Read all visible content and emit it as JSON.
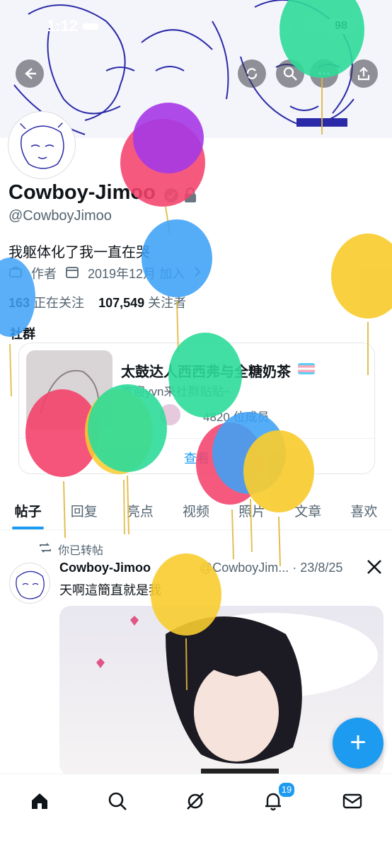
{
  "status_bar": {
    "time": "1:12",
    "battery": "98"
  },
  "profile": {
    "name": "Cowboy-Jimoo",
    "handle": "@CowboyJimoo",
    "bio": "我躯体化了我一直在哭",
    "role": "作者",
    "joined": "2019年12月 加入",
    "following_count": "163",
    "following_label": "正在关注",
    "followers_count": "107,549",
    "followers_label": "关注者"
  },
  "community": {
    "section_label": "社群",
    "title": "太鼓达人西西弗与全糖奶茶",
    "subtitle": "欢迎yvn来社群贴贴~",
    "members": "4820 位成员",
    "view_label": "查看"
  },
  "tabs": [
    "帖子",
    "回复",
    "亮点",
    "视频",
    "照片",
    "文章",
    "喜欢"
  ],
  "post": {
    "retweet_label": "你已转帖",
    "author": "Cowboy-Jimoo",
    "handle_date": "@CowboyJim... · 23/8/25",
    "text": "天啊這簡直就是我"
  },
  "fab_label": "+",
  "nav": {
    "notifications_badge": "19"
  },
  "icons": [
    "back-arrow-icon",
    "refresh-icon",
    "search-icon",
    "share-icon",
    "more-icon",
    "verified-icon",
    "lock-icon",
    "briefcase-icon",
    "calendar-icon",
    "chevron-right-icon",
    "retweet-icon",
    "x-logo-icon",
    "home-icon",
    "grok-icon",
    "bell-icon",
    "mail-icon",
    "plus-icon"
  ],
  "colors": {
    "accent": "#1d9bf0",
    "balloon_red": "#f4436c",
    "balloon_green": "#2edb9a",
    "balloon_blue": "#3ea2f7",
    "balloon_yellow": "#f8cc2f",
    "balloon_purple": "#a638e6"
  }
}
